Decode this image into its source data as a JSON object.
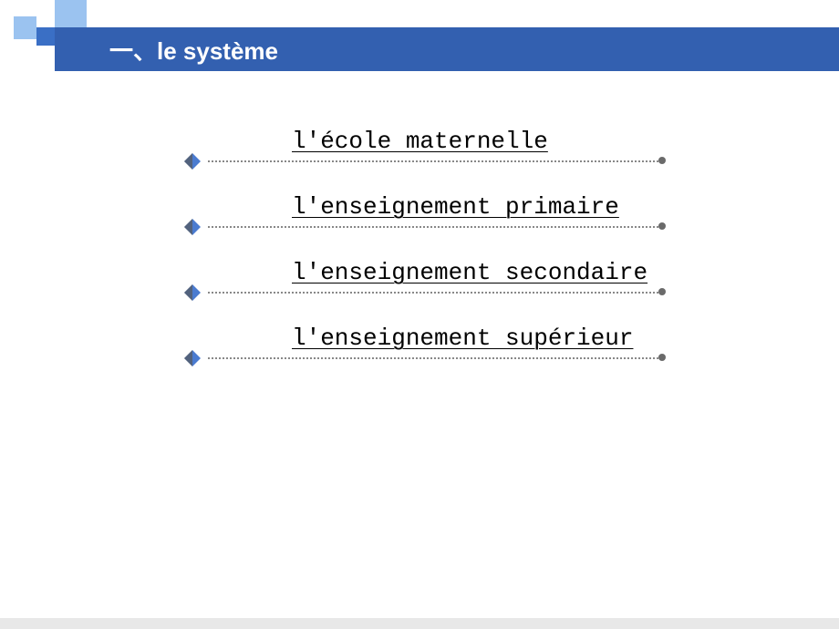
{
  "header": {
    "title": "一、le système"
  },
  "items": [
    {
      "label": "l'école maternelle"
    },
    {
      "label": "l'enseignement primaire"
    },
    {
      "label": "l'enseignement secondaire"
    },
    {
      "label": "l'enseignement supérieur"
    }
  ],
  "colors": {
    "titleBarBg": "#3360b0",
    "lightBlue": "#9bc3f0",
    "darkBlue": "#3a6fc5"
  }
}
